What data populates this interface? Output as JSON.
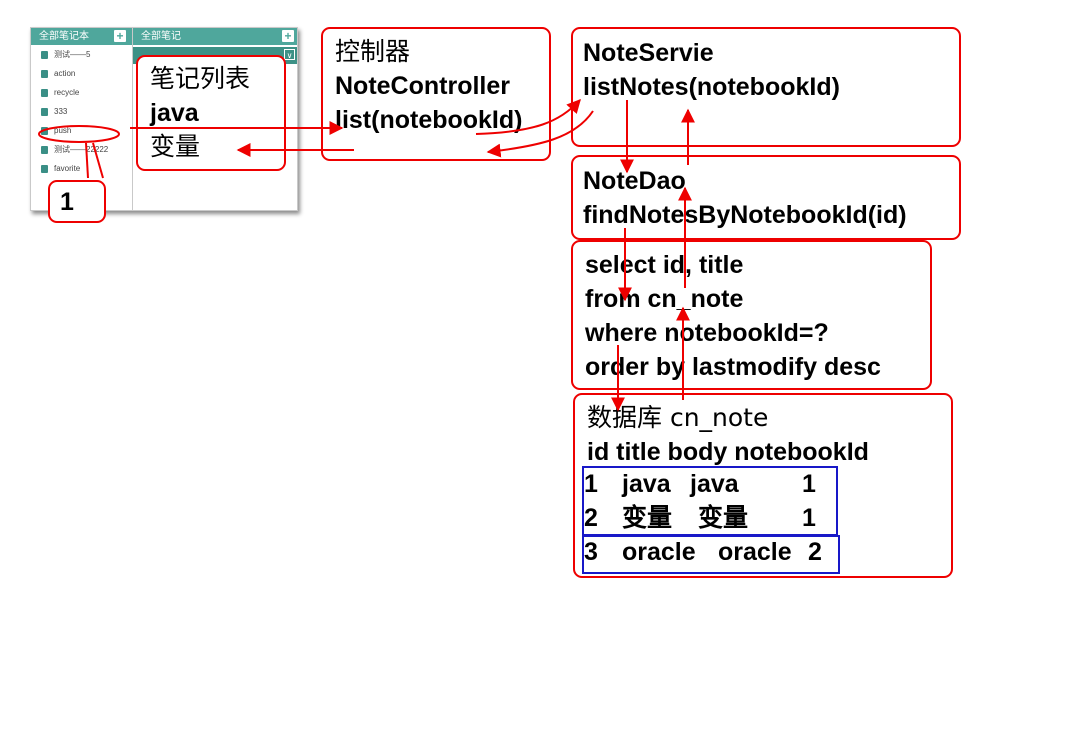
{
  "app": {
    "left_header": "全部笔记本",
    "right_header": "全部笔记",
    "notebooks": [
      "测试——5",
      "action",
      "recycle",
      "333",
      "push",
      "测试——22222",
      "favorite"
    ]
  },
  "callout": {
    "label": "1"
  },
  "note_list_box": {
    "lines": [
      "笔记列表",
      "java",
      "变量"
    ]
  },
  "controller_box": {
    "lines": [
      "控制器",
      "NoteController",
      "list(notebookId)"
    ]
  },
  "service_box": {
    "lines": [
      "NoteServie",
      "listNotes(notebookId)"
    ]
  },
  "dao_box": {
    "lines": [
      "NoteDao",
      "findNotesByNotebookId(id)"
    ]
  },
  "sql_box": {
    "lines": [
      "select id, title",
      "from cn_note",
      "where notebookId=?",
      "order by lastmodify desc"
    ]
  },
  "db_box": {
    "title": "数据库 cn_note",
    "columns": "id title body notebookId",
    "rows": [
      {
        "id": "1",
        "title": "java",
        "body": "java",
        "notebookId": "1"
      },
      {
        "id": "2",
        "title": "变量",
        "body": "变量",
        "notebookId": "1"
      },
      {
        "id": "3",
        "title": "oracle",
        "body": "oracle",
        "notebookId": "2"
      }
    ]
  },
  "colors": {
    "box_border": "#ee0000",
    "arrow": "#ee0000",
    "highlight": "#1818c8",
    "app_header": "#4fa79c"
  }
}
